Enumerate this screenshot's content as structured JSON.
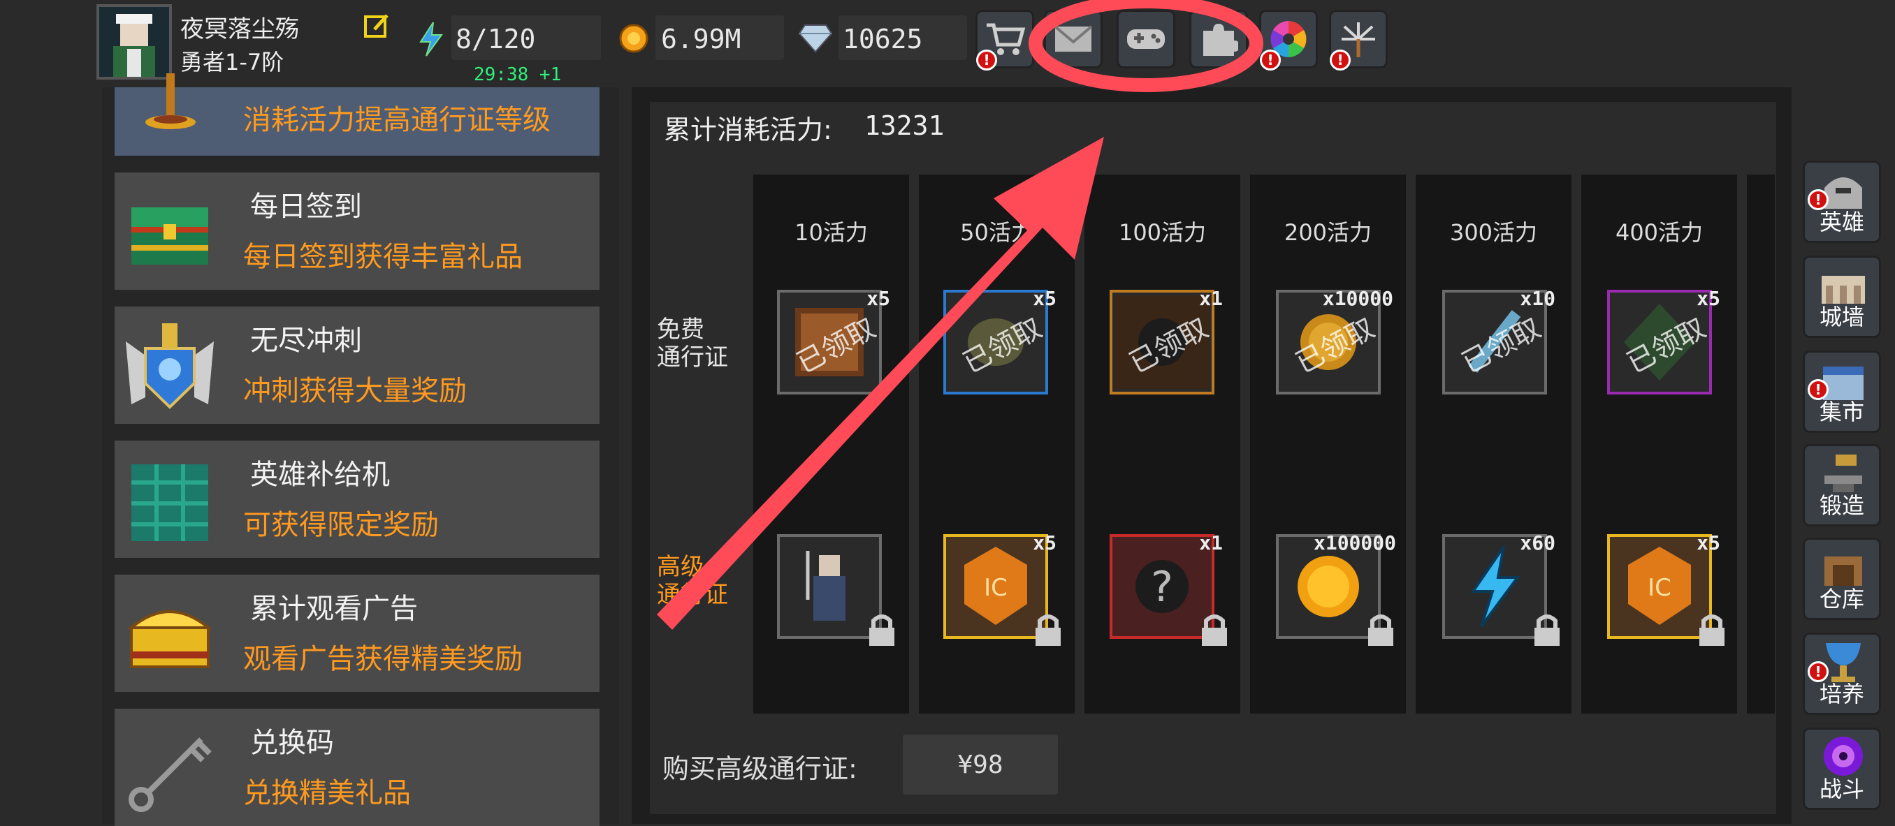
{
  "player": {
    "name": "夜冥落尘殇",
    "rank": "勇者1-7阶"
  },
  "stats": {
    "energy": "8/120",
    "energy_timer": "29:38 +1",
    "gold": "6.99M",
    "gems": "10625"
  },
  "top_buttons": [
    "shop-cart-icon",
    "mail-icon",
    "gamepad-icon",
    "puzzle-icon",
    "color-wheel-icon",
    "fireworks-icon"
  ],
  "menu": [
    {
      "title": "",
      "desc": "消耗活力提高通行证等级"
    },
    {
      "title": "每日签到",
      "desc": "每日签到获得丰富礼品"
    },
    {
      "title": "无尽冲刺",
      "desc": "冲刺获得大量奖励"
    },
    {
      "title": "英雄补给机",
      "desc": "可获得限定奖励"
    },
    {
      "title": "累计观看广告",
      "desc": "观看广告获得精美奖励"
    },
    {
      "title": "兑换码",
      "desc": "兑换精美礼品"
    }
  ],
  "pass": {
    "total_label": "累计消耗活力:",
    "total_value": "13231",
    "free_label": "免费\n通行证",
    "premium_label": "高级\n通行证",
    "claimed_text": "已领取",
    "tiers": [
      "10活力",
      "50活力",
      "100活力",
      "200活力",
      "300活力",
      "400活力"
    ],
    "free_qty": [
      "x5",
      "x5",
      "x1",
      "x10000",
      "x10",
      "x5"
    ],
    "premium_qty": [
      "",
      "x5",
      "x1",
      "x100000",
      "x60",
      "x5"
    ],
    "buy_label": "购买高级通行证:",
    "price": "¥98"
  },
  "side_nav": [
    "英雄",
    "城墙",
    "集市",
    "锻造",
    "仓库",
    "培养",
    "战斗"
  ],
  "colors": {
    "accent_orange": "#ff9a1f",
    "timer_green": "#2ef07a",
    "annotation_red": "#ff4a58"
  }
}
